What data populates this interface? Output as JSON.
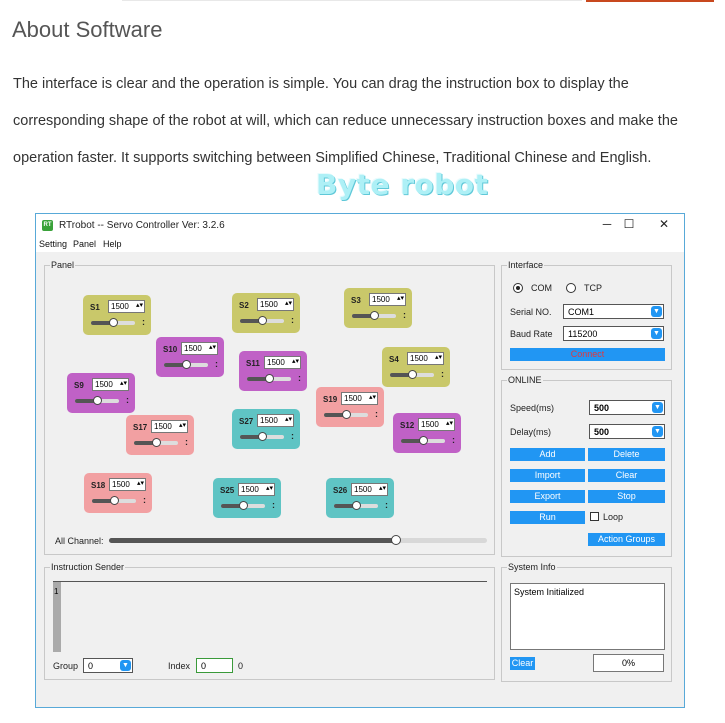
{
  "page": {
    "heading": "About Software",
    "paragraph": "The interface is clear and the operation is simple. You can drag the instruction box to display the corresponding shape of the robot at will, which can reduce unnecessary instruction boxes and make the operation faster. It supports switching between Simplified Chinese, Traditional Chinese and English.",
    "brand": "Byte robot"
  },
  "window": {
    "title": "RTrobot -- Servo Controller  Ver: 3.2.6",
    "icon": "robot-app-icon",
    "minimize": "─",
    "maximize": "☐",
    "close": "✕"
  },
  "menu": [
    "Setting",
    "Panel",
    "Help"
  ],
  "panel": {
    "label": "Panel",
    "all_channel_label": "All Channel:",
    "all_channel_fraction": 0.76
  },
  "servos": [
    {
      "name": "S1",
      "value": "1500",
      "color": "#c9c86a"
    },
    {
      "name": "S2",
      "value": "1500",
      "color": "#c9c86a"
    },
    {
      "name": "S3",
      "value": "1500",
      "color": "#c9c86a"
    },
    {
      "name": "S10",
      "value": "1500",
      "color": "#c061c6"
    },
    {
      "name": "S11",
      "value": "1500",
      "color": "#c061c6"
    },
    {
      "name": "S4",
      "value": "1500",
      "color": "#c9c86a"
    },
    {
      "name": "S9",
      "value": "1500",
      "color": "#c061c6"
    },
    {
      "name": "S19",
      "value": "1500",
      "color": "#f2a0a2"
    },
    {
      "name": "S17",
      "value": "1500",
      "color": "#f2a0a2"
    },
    {
      "name": "S27",
      "value": "1500",
      "color": "#5fc4c4"
    },
    {
      "name": "S12",
      "value": "1500",
      "color": "#c061c6"
    },
    {
      "name": "S18",
      "value": "1500",
      "color": "#f2a0a2"
    },
    {
      "name": "S25",
      "value": "1500",
      "color": "#5fc4c4"
    },
    {
      "name": "S26",
      "value": "1500",
      "color": "#5fc4c4"
    }
  ],
  "interface": {
    "label": "Interface",
    "com_label": "COM",
    "tcp_label": "TCP",
    "serial_label": "Serial NO.",
    "serial_value": "COM1",
    "baud_label": "Baud Rate",
    "baud_value": "115200",
    "connect_label": "Connect",
    "connect_color": "#e0383e"
  },
  "online": {
    "label": "ONLINE",
    "speed_label": "Speed(ms)",
    "speed_value": "500",
    "delay_label": "Delay(ms)",
    "delay_value": "500",
    "add": "Add",
    "delete": "Delete",
    "import": "Import",
    "clear": "Clear",
    "export": "Export",
    "stop": "Stop",
    "run": "Run",
    "loop_label": "Loop",
    "action_groups": "Action Groups"
  },
  "sender": {
    "label": "Instruction Sender",
    "line_number": "1",
    "group_label": "Group",
    "group_value": "0",
    "index_label": "Index",
    "index_value": "0",
    "index_total": "0"
  },
  "sysinfo": {
    "label": "System Info",
    "message": "System Initialized",
    "clear_label": "Clear",
    "progress_text": "0%",
    "progress_value": 0
  },
  "colors": {
    "accent": "#2196f3",
    "window_border": "#58a9d8"
  }
}
